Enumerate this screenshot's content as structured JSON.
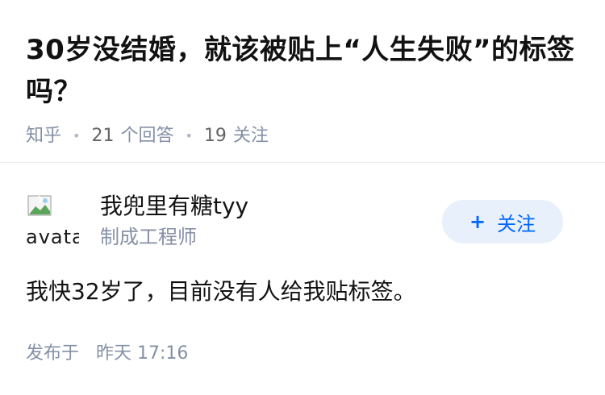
{
  "question": {
    "title": "30岁没结婚，就该被贴上“人生失败”的标签吗？",
    "source": "知乎",
    "answer_count": "21",
    "answer_label": "个回答",
    "follower_count": "19",
    "follower_label": "关注"
  },
  "answer": {
    "author": {
      "avatar_alt": "avatar",
      "name": "我兜里有糖tyy",
      "description": "制成工程师"
    },
    "follow_button": {
      "icon": "+",
      "label": "关注"
    },
    "content": "我快32岁了，目前没有人给我贴标签。",
    "footer": {
      "published_label": "发布于",
      "time": "昨天 17:16"
    }
  },
  "colors": {
    "accent": "#0066ff",
    "follow_bg": "#e8f0fb",
    "meta_text": "#8590a6",
    "title_text": "#121212"
  },
  "icons": {
    "avatar": "broken-image-icon",
    "meta_separator": "dot-separator-icon"
  }
}
